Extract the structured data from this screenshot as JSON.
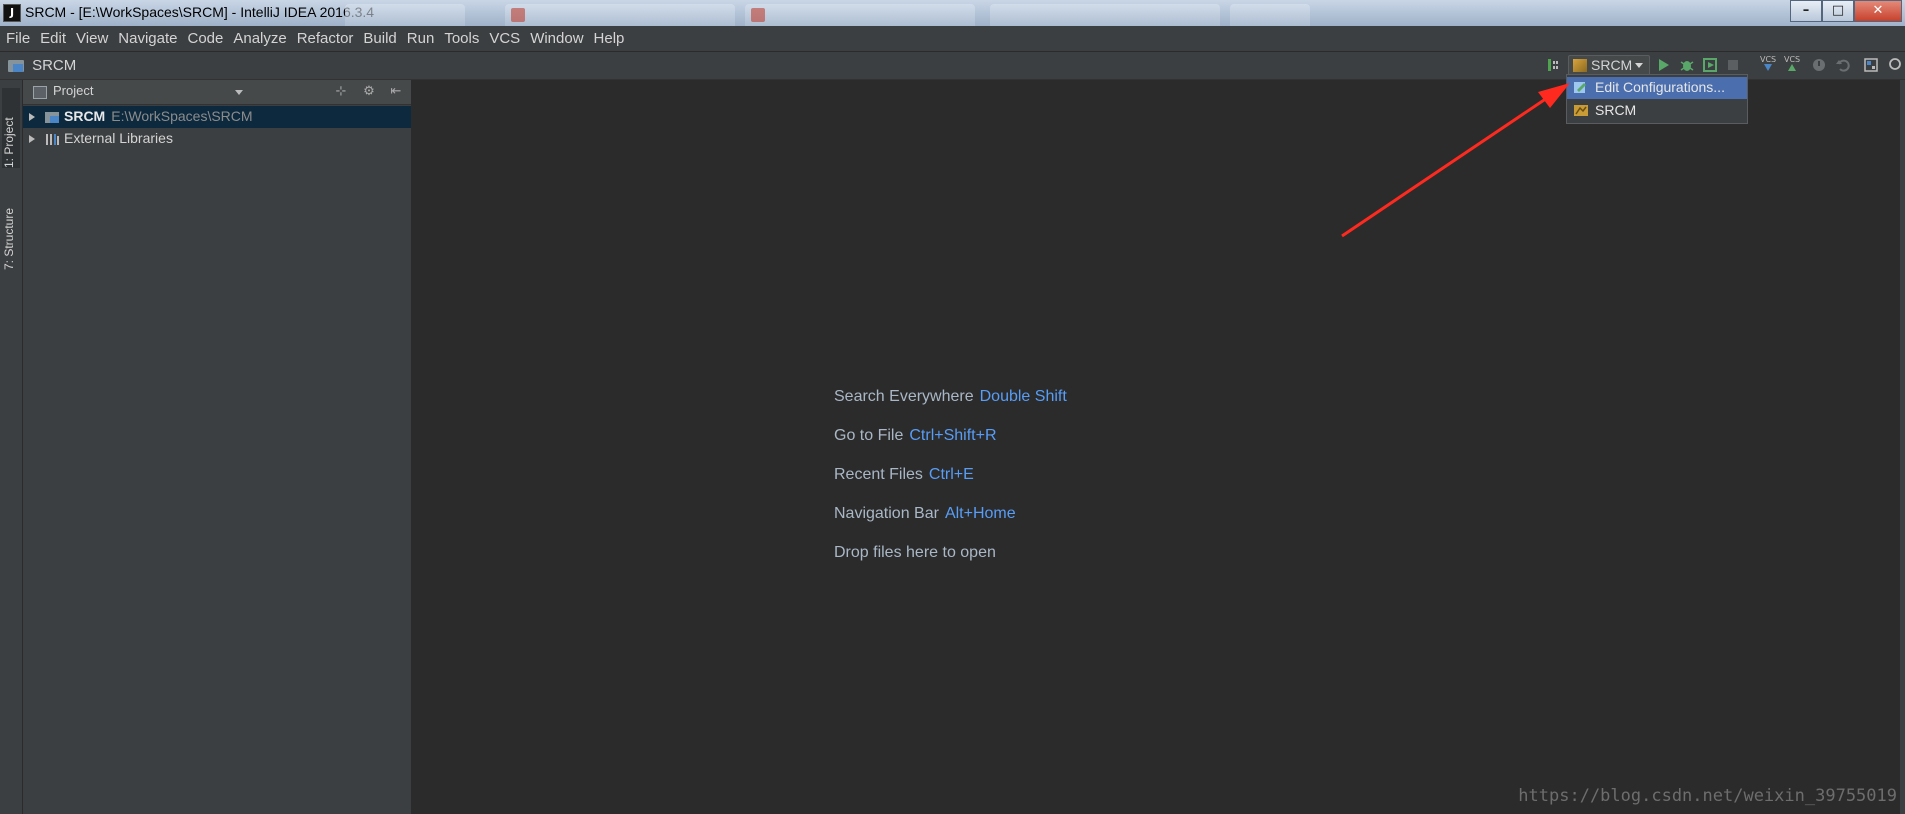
{
  "window": {
    "title": "SRCM - [E:\\WorkSpaces\\SRCM] - IntelliJ IDEA 2016.3.4",
    "app_icon": "J",
    "controls": {
      "minimize": "–",
      "maximize": "□",
      "close": "✕"
    }
  },
  "menubar": {
    "items": [
      "File",
      "Edit",
      "View",
      "Navigate",
      "Code",
      "Analyze",
      "Refactor",
      "Build",
      "Run",
      "Tools",
      "VCS",
      "Window",
      "Help"
    ]
  },
  "navbar": {
    "breadcrumb": "SRCM",
    "run_config": "SRCM",
    "icons": [
      "make-project-icon",
      "run-icon",
      "debug-icon",
      "coverage-icon",
      "stop-icon",
      "vcs-update-icon",
      "vcs-commit-icon",
      "history-icon",
      "revert-icon",
      "project-structure-icon"
    ],
    "vcs_label": "VCS"
  },
  "dropdown": {
    "items": [
      {
        "label": "Edit Configurations...",
        "icon": "edit-config-icon",
        "selected": true
      },
      {
        "label": "SRCM",
        "icon": "run-config-icon",
        "selected": false
      }
    ]
  },
  "left_stripe": {
    "tabs": [
      "1: Project",
      "7: Structure"
    ]
  },
  "project_panel": {
    "title": "Project",
    "tree": [
      {
        "name": "SRCM",
        "path": "E:\\WorkSpaces\\SRCM",
        "selected": true
      },
      {
        "name": "External Libraries",
        "path": "",
        "selected": false
      }
    ]
  },
  "editor": {
    "hints": [
      {
        "text": "Search Everywhere",
        "key": "Double Shift"
      },
      {
        "text": "Go to File",
        "key": "Ctrl+Shift+R"
      },
      {
        "text": "Recent Files",
        "key": "Ctrl+E"
      },
      {
        "text": "Navigation Bar",
        "key": "Alt+Home"
      },
      {
        "text": "Drop files here to open",
        "key": ""
      }
    ]
  },
  "watermark": "https://blog.csdn.net/weixin_39755019",
  "colors": {
    "background": "#2b2b2b",
    "panel": "#3c3f41",
    "selection": "#4b6eaf",
    "shortcut": "#589df6",
    "annotation_arrow": "#ff2a1f"
  }
}
